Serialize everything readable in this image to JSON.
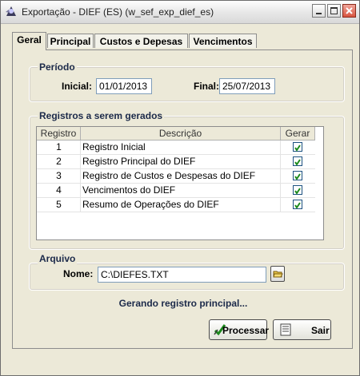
{
  "window": {
    "title": "Exportação - DIEF (ES) (w_sef_exp_dief_es)"
  },
  "tabs": [
    {
      "label": "Geral",
      "active": true
    },
    {
      "label": "Principal",
      "active": false
    },
    {
      "label": "Custos e Depesas",
      "active": false
    },
    {
      "label": "Vencimentos",
      "active": false
    }
  ],
  "periodo": {
    "group_label": "Período",
    "inicial_label": "Inicial:",
    "inicial_value": "01/01/2013",
    "final_label": "Final:",
    "final_value": "25/07/2013"
  },
  "registros": {
    "group_label": "Registros a serem gerados",
    "columns": [
      "Registro",
      "Descrição",
      "Gerar"
    ],
    "rows": [
      {
        "registro": "1",
        "descricao": "Registro Inicial",
        "gerar": true
      },
      {
        "registro": "2",
        "descricao": "Registro Principal do DIEF",
        "gerar": true
      },
      {
        "registro": "3",
        "descricao": "Registro de Custos e Despesas do DIEF",
        "gerar": true
      },
      {
        "registro": "4",
        "descricao": "Vencimentos do DIEF",
        "gerar": true
      },
      {
        "registro": "5",
        "descricao": "Resumo de Operações do DIEF",
        "gerar": true
      }
    ]
  },
  "arquivo": {
    "group_label": "Arquivo",
    "nome_label": "Nome:",
    "nome_value": "C:\\DIEFES.TXT"
  },
  "status_text": "Gerando registro principal...",
  "buttons": {
    "processar": "Processar",
    "sair": "Sair"
  },
  "colors": {
    "accent_check": "#1c8a1c",
    "group_label": "#1c2a4a",
    "close_button": "#d8543f"
  }
}
